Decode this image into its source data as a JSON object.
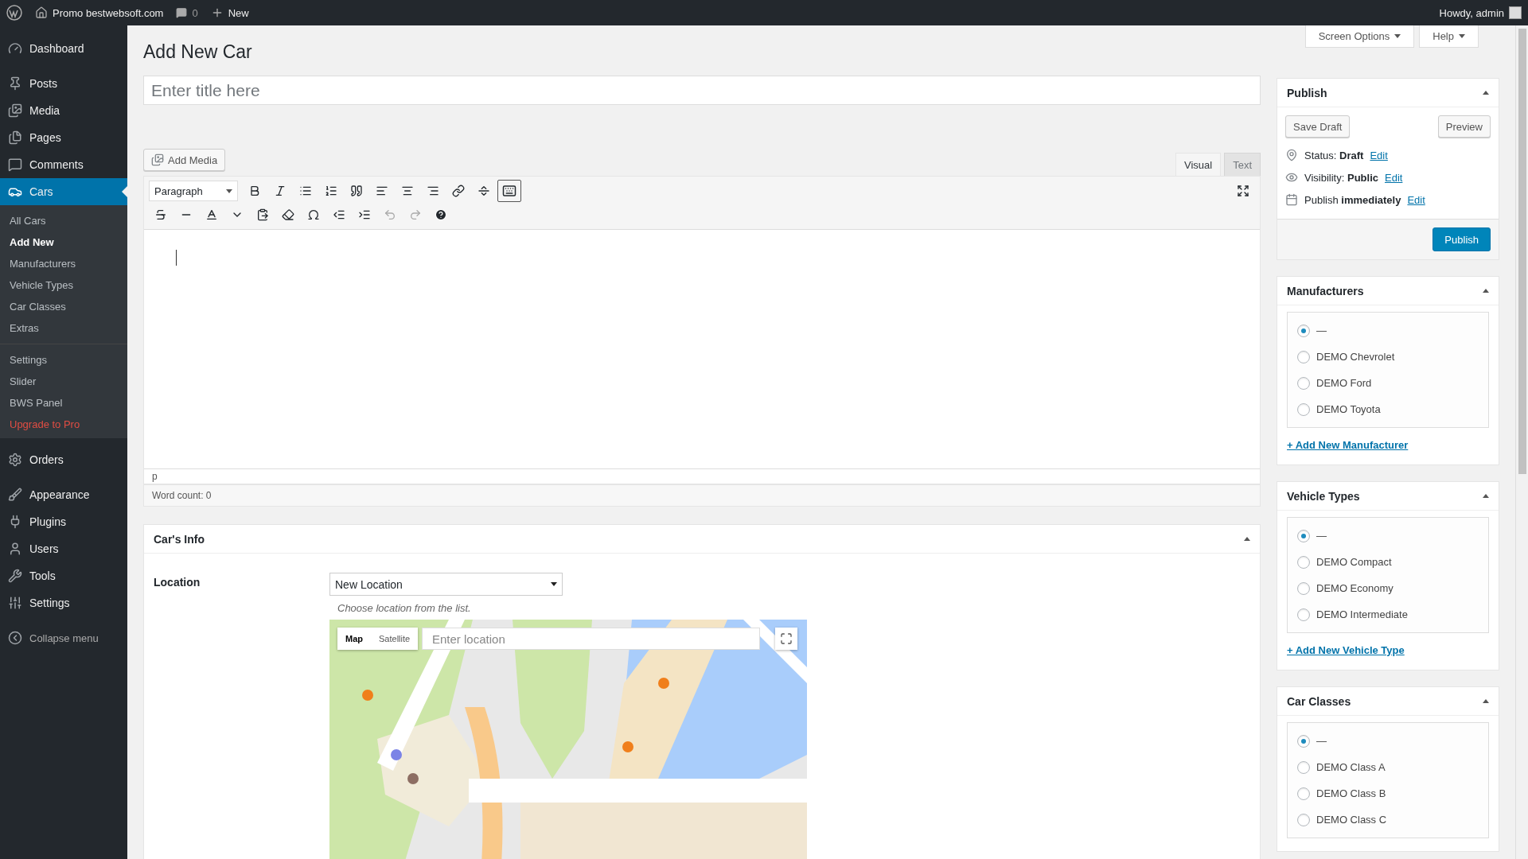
{
  "admin_bar": {
    "site": "Promo bestwebsoft.com",
    "comments": "0",
    "new": "New",
    "greeting": "Howdy, admin"
  },
  "sidebar": {
    "groups": [
      {
        "items": [
          {
            "label": "Dashboard",
            "selected": false
          }
        ]
      },
      {
        "items": [
          {
            "label": "Posts",
            "selected": false
          },
          {
            "label": "Media",
            "selected": false
          },
          {
            "label": "Pages",
            "selected": false
          },
          {
            "label": "Comments",
            "selected": false
          },
          {
            "label": "Cars",
            "selected": true,
            "submenu": [
              {
                "items": [
                  {
                    "label": "All Cars",
                    "selected": false,
                    "kind": "link"
                  },
                  {
                    "label": "Add New",
                    "selected": true,
                    "kind": "link"
                  },
                  {
                    "label": "Manufacturers",
                    "selected": false,
                    "kind": "link"
                  },
                  {
                    "label": "Vehicle Types",
                    "selected": false,
                    "kind": "link"
                  },
                  {
                    "label": "Car Classes",
                    "selected": false,
                    "kind": "link"
                  },
                  {
                    "label": "Extras",
                    "selected": false,
                    "kind": "link"
                  }
                ]
              },
              {
                "items": [
                  {
                    "label": "Settings",
                    "selected": false,
                    "kind": "link"
                  },
                  {
                    "label": "Slider",
                    "selected": false,
                    "kind": "link"
                  },
                  {
                    "label": "BWS Panel",
                    "selected": false,
                    "kind": "link"
                  },
                  {
                    "label": "Upgrade to Pro",
                    "selected": false,
                    "kind": "promo"
                  }
                ]
              }
            ]
          }
        ]
      },
      {
        "items": [
          {
            "label": "Orders",
            "selected": false
          }
        ]
      },
      {
        "items": [
          {
            "label": "Appearance",
            "selected": false
          },
          {
            "label": "Plugins",
            "selected": false
          },
          {
            "label": "Users",
            "selected": false
          },
          {
            "label": "Tools",
            "selected": false
          },
          {
            "label": "Settings",
            "selected": false
          }
        ]
      }
    ],
    "collapse": "Collapse menu"
  },
  "header": {
    "screen_options": "Screen Options",
    "help": "Help"
  },
  "page_title": "Add New Car",
  "title_field": {
    "placeholder": "Enter title here"
  },
  "editor": {
    "add_media": "Add Media",
    "tabs": [
      {
        "label": "Visual",
        "selected": true
      },
      {
        "label": "Text",
        "selected": false
      }
    ],
    "format": "Paragraph",
    "toolbar_toggle_on": true,
    "undo_disabled": true,
    "redo_disabled": true,
    "path": "p",
    "word_count": "Word count: 0"
  },
  "cars_info": {
    "title": "Car's Info",
    "location_label": "Location",
    "location_value": "New Location",
    "hint": "Choose location from the list.",
    "map": {
      "kind": "picture",
      "tabs": [
        {
          "label": "Map",
          "selected": true
        },
        {
          "label": "Satellite",
          "selected": false
        }
      ],
      "search": {
        "placeholder": "Enter location"
      }
    }
  },
  "publish": {
    "title": "Publish",
    "save_draft": "Save Draft",
    "preview": "Preview",
    "rows": [
      {
        "label": "Status:",
        "value": "Draft",
        "link": "Edit"
      },
      {
        "label": "Visibility:",
        "value": "Public",
        "link": "Edit"
      },
      {
        "label": "Publish",
        "value": "immediately",
        "link": "Edit"
      }
    ],
    "button": "Publish"
  },
  "taxonomies": [
    {
      "title": "Manufacturers",
      "options": [
        {
          "label": "—",
          "selected": true
        },
        {
          "label": "DEMO Chevrolet",
          "selected": false
        },
        {
          "label": "DEMO Ford",
          "selected": false
        },
        {
          "label": "DEMO Toyota",
          "selected": false
        }
      ],
      "add_link": "+ Add New Manufacturer"
    },
    {
      "title": "Vehicle Types",
      "options": [
        {
          "label": "—",
          "selected": true
        },
        {
          "label": "DEMO Compact",
          "selected": false
        },
        {
          "label": "DEMO Economy",
          "selected": false
        },
        {
          "label": "DEMO Intermediate",
          "selected": false
        }
      ],
      "add_link": "+ Add New Vehicle Type"
    },
    {
      "title": "Car Classes",
      "options": [
        {
          "label": "—",
          "selected": true
        },
        {
          "label": "DEMO Class A",
          "selected": false
        },
        {
          "label": "DEMO Class B",
          "selected": false
        },
        {
          "label": "DEMO Class C",
          "selected": false
        }
      ]
    }
  ]
}
